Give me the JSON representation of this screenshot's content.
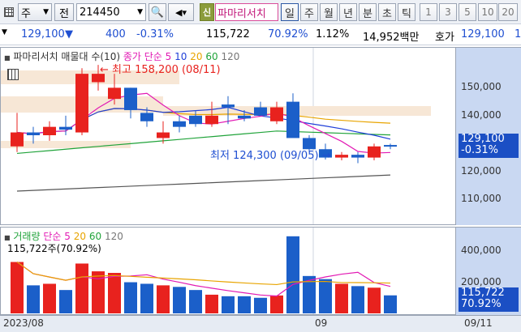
{
  "toolbar": {
    "market": "주",
    "search_label": "전",
    "code": "214450",
    "pama_badge": "신",
    "pama_name": "파마리서치",
    "periods": [
      "일",
      "주",
      "월",
      "년",
      "분",
      "초",
      "틱"
    ],
    "active_period": "일",
    "intervals": [
      "1",
      "3",
      "5",
      "10",
      "20"
    ]
  },
  "quote": {
    "price": "129,100",
    "change": "400",
    "change_pct": "-0.31%",
    "volume": "115,722",
    "ratio": "70.92%",
    "turnover_pct": "1.12%",
    "amount": "14,952백만",
    "ask_label": "호가",
    "ask_price": "129,100",
    "ask_tail": "1"
  },
  "price_panel": {
    "legend_name": "파마리서치 매물대 수(10)",
    "legend_ma_label": "종가 단순",
    "legend_ma": [
      "5",
      "10",
      "20",
      "60",
      "120"
    ],
    "high_label": "최고 158,200 (08/11)",
    "low_label": "최저 124,300 (09/05)",
    "axis_ticks": [
      "150,000",
      "140,000",
      "130,000",
      "120,000",
      "110,000"
    ],
    "current_price": "129,100",
    "current_change": "-0.31%"
  },
  "volume_panel": {
    "legend_name": "거래량",
    "legend_ma_label": "단순",
    "legend_ma": [
      "5",
      "20",
      "60",
      "120"
    ],
    "value_label": "115,722주(70.92%)",
    "axis_ticks": [
      "400,000",
      "200,000"
    ],
    "current_volume": "115,722",
    "current_ratio": "70.92%"
  },
  "dates": {
    "start": "2023/08",
    "month": "09",
    "last": "09/11"
  },
  "colors": {
    "up": "#e8221e",
    "down": "#1b5fc9",
    "ma5": "#e21ab4",
    "ma10": "#1f3fd8",
    "ma20": "#e8a400",
    "ma60": "#20a33a",
    "ma120": "#555555"
  },
  "chart_data": {
    "type": "candlestick",
    "ylim": [
      104000,
      162000
    ],
    "volume_ylim": [
      0,
      520000
    ],
    "candles": [
      {
        "o": 129000,
        "h": 141000,
        "l": 127000,
        "c": 134000,
        "v": 330000
      },
      {
        "o": 134000,
        "h": 136000,
        "l": 130000,
        "c": 133000,
        "v": 180000
      },
      {
        "o": 133000,
        "h": 138000,
        "l": 131000,
        "c": 136000,
        "v": 190000
      },
      {
        "o": 136000,
        "h": 140000,
        "l": 133000,
        "c": 135000,
        "v": 150000
      },
      {
        "o": 134000,
        "h": 157000,
        "l": 133000,
        "c": 155000,
        "v": 320000
      },
      {
        "o": 152000,
        "h": 158200,
        "l": 149000,
        "c": 155000,
        "v": 270000
      },
      {
        "o": 146000,
        "h": 155000,
        "l": 144000,
        "c": 150000,
        "v": 260000
      },
      {
        "o": 150000,
        "h": 150000,
        "l": 139000,
        "c": 142000,
        "v": 200000
      },
      {
        "o": 141000,
        "h": 143000,
        "l": 136000,
        "c": 138000,
        "v": 190000
      },
      {
        "o": 132000,
        "h": 138000,
        "l": 130000,
        "c": 134000,
        "v": 180000
      },
      {
        "o": 138000,
        "h": 140000,
        "l": 134000,
        "c": 136000,
        "v": 170000
      },
      {
        "o": 140000,
        "h": 142000,
        "l": 136000,
        "c": 137000,
        "v": 150000
      },
      {
        "o": 137000,
        "h": 145000,
        "l": 136000,
        "c": 140000,
        "v": 120000
      },
      {
        "o": 144000,
        "h": 147000,
        "l": 137000,
        "c": 143000,
        "v": 110000
      },
      {
        "o": 140000,
        "h": 142000,
        "l": 138000,
        "c": 139000,
        "v": 110000
      },
      {
        "o": 143000,
        "h": 145000,
        "l": 140000,
        "c": 140000,
        "v": 100000
      },
      {
        "o": 138000,
        "h": 145000,
        "l": 137000,
        "c": 143000,
        "v": 115000
      },
      {
        "o": 145000,
        "h": 148000,
        "l": 136000,
        "c": 132000,
        "v": 495000
      },
      {
        "o": 132000,
        "h": 133000,
        "l": 127000,
        "c": 128000,
        "v": 240000
      },
      {
        "o": 128000,
        "h": 130000,
        "l": 124300,
        "c": 125000,
        "v": 220000
      },
      {
        "o": 125000,
        "h": 127000,
        "l": 124000,
        "c": 126000,
        "v": 190000
      },
      {
        "o": 126000,
        "h": 127000,
        "l": 123000,
        "c": 125000,
        "v": 175000
      },
      {
        "o": 125000,
        "h": 130000,
        "l": 124000,
        "c": 129000,
        "v": 165000
      },
      {
        "o": 129500,
        "h": 130000,
        "l": 128000,
        "c": 129100,
        "v": 115722
      }
    ]
  }
}
